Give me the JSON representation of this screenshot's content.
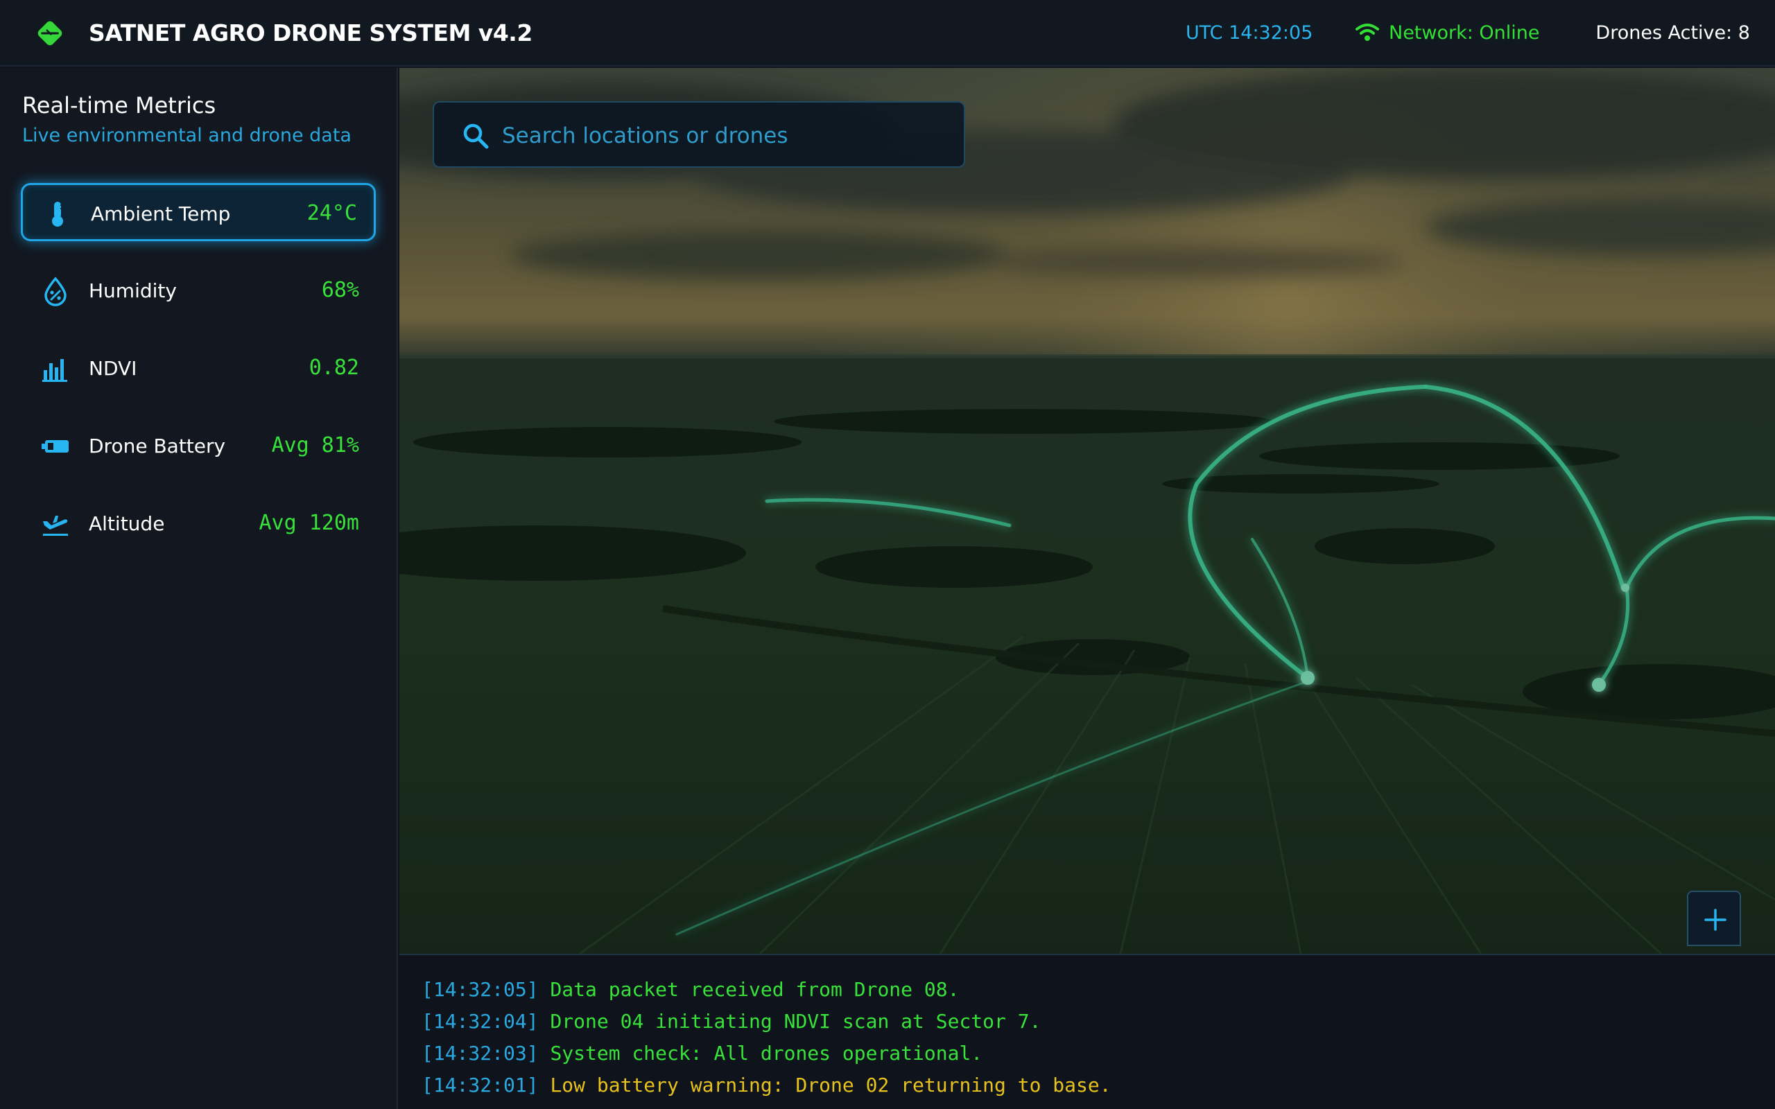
{
  "header": {
    "title": "SATNET AGRO DRONE SYSTEM v4.2",
    "logo_icon": "leaf-icon",
    "utc": "UTC 14:32:05",
    "network_icon": "wifi-icon",
    "network": "Network: Online",
    "drones_active": "Drones Active: 8"
  },
  "sidebar": {
    "title": "Real-time Metrics",
    "subtitle": "Live environmental and drone data",
    "metrics": [
      {
        "label": "Ambient Temp",
        "value": "24°C",
        "icon": "thermometer-icon",
        "active": true
      },
      {
        "label": "Humidity",
        "value": "68%",
        "icon": "humidity-icon",
        "active": false
      },
      {
        "label": "NDVI",
        "value": "0.82",
        "icon": "bar-chart-icon",
        "active": false
      },
      {
        "label": "Drone Battery",
        "value": "Avg 81%",
        "icon": "battery-icon",
        "active": false
      },
      {
        "label": "Altitude",
        "value": "Avg 120m",
        "icon": "airplane-icon",
        "active": false
      }
    ]
  },
  "map": {
    "search_placeholder": "Search locations or drones",
    "search_value": "",
    "zoom_in_icon": "plus-icon"
  },
  "log": [
    {
      "time": "[14:32:05]",
      "message": "Data packet received from Drone 08.",
      "level": "info"
    },
    {
      "time": "[14:32:04]",
      "message": "Drone 04 initiating NDVI scan at Sector 7.",
      "level": "info"
    },
    {
      "time": "[14:32:03]",
      "message": "System check: All drones operational.",
      "level": "info"
    },
    {
      "time": "[14:32:01]",
      "message": "Low battery warning: Drone 02 returning to base.",
      "level": "warning"
    }
  ],
  "colors": {
    "accent_blue": "#2aa8e0",
    "accent_green": "#38e23a",
    "warning": "#e8c21c",
    "background": "#0f131b"
  }
}
